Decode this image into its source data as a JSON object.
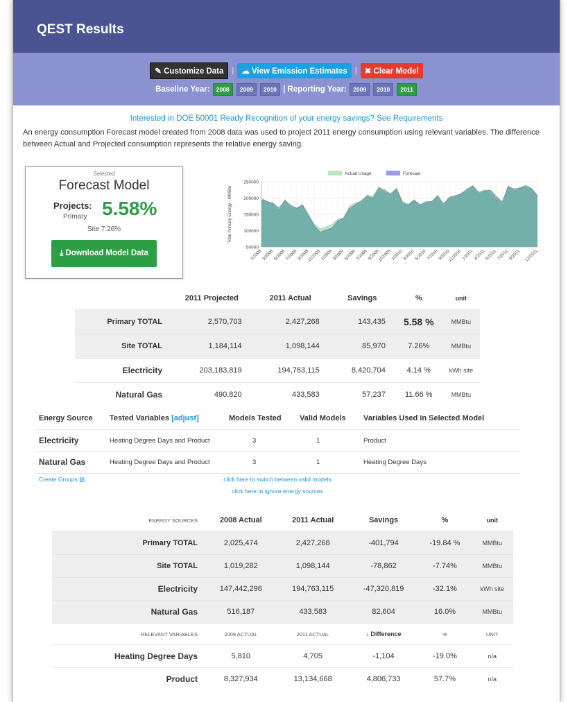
{
  "header": {
    "title": "QEST Results"
  },
  "toolbar": {
    "customize_label": "✎ Customize Data",
    "emission_label": "☁ View Emission Estimates",
    "clear_label": "✖ Clear Model",
    "baseline_label": "Baseline Year:",
    "reporting_label": "| Reporting Year:",
    "baseline_years": [
      "2008",
      "2009",
      "2010"
    ],
    "reporting_years": [
      "2009",
      "2010",
      "2011"
    ],
    "baseline_selected": "2008",
    "reporting_selected": "2011"
  },
  "interest_link": "Interested in DOE 50001 Ready Recognition of your energy savings? See Requirements",
  "description": "An energy consumption Forecast model created from 2008 data was used to project 2011 energy consumption using relevant variables. The difference between Actual and Projected consumption represents the relative energy saving.",
  "forecast_box": {
    "selected": "Selected",
    "title": "Forecast Model",
    "projects_label": "Projects:",
    "primary_label": "Primary",
    "primary_pct": "5.58%",
    "site_text": "Site 7.26%",
    "download_label": "⤓ Download Model Data"
  },
  "chart_data": {
    "type": "area",
    "ylabel": "Total Primary Energy - MMBtu",
    "legend": [
      "Actual Usage",
      "Forecast"
    ],
    "legend_position": "top",
    "colors": {
      "actual": "#b8e6b8",
      "forecast": "#9d9be6",
      "overlap": "#6fb0a4"
    },
    "ylim": [
      50000,
      250000
    ],
    "yticks": [
      "250000",
      "200000",
      "150000",
      "100000",
      "50000"
    ],
    "x": [
      "1/2008",
      "2/2008",
      "3/2008",
      "4/2008",
      "5/2008",
      "6/2008",
      "7/2008",
      "8/2008",
      "9/2008",
      "10/2008",
      "11/2008",
      "12/2008",
      "1/2009",
      "2/2009",
      "3/2009",
      "4/2009",
      "5/2009",
      "6/2009",
      "7/2009",
      "8/2009",
      "9/2009",
      "10/2009",
      "11/2009",
      "12/2009",
      "1/2010",
      "2/2010",
      "3/2010",
      "4/2010",
      "5/2010",
      "6/2010",
      "7/2010",
      "8/2010",
      "9/2010",
      "10/2010",
      "11/2010",
      "12/2010",
      "1/2011",
      "2/2011",
      "3/2011",
      "4/2011",
      "5/2011",
      "6/2011",
      "7/2011",
      "8/2011",
      "9/2011",
      "10/2011",
      "11/2011",
      "12/2011"
    ],
    "xticks": [
      "1/2008",
      "3/2008",
      "5/2008",
      "7/2008",
      "9/2008",
      "11/2008",
      "1/2009",
      "3/2009",
      "5/2009",
      "7/2009",
      "9/2009",
      "11/2009",
      "1/2010",
      "3/2010",
      "5/2010",
      "7/2010",
      "9/2010",
      "11/2010",
      "1/2011",
      "3/2011",
      "5/2011",
      "7/2011",
      "9/2011",
      "12/2011"
    ],
    "series": [
      {
        "name": "Actual Usage",
        "values": [
          200000,
          188000,
          185000,
          165000,
          195000,
          175000,
          170000,
          180000,
          150000,
          120000,
          105000,
          112000,
          118000,
          135000,
          140000,
          175000,
          185000,
          190000,
          210000,
          205000,
          235000,
          220000,
          215000,
          230000,
          190000,
          182000,
          195000,
          178000,
          190000,
          188000,
          210000,
          180000,
          205000,
          205000,
          215000,
          225000,
          240000,
          215000,
          225000,
          220000,
          200000,
          185000,
          238000,
          225000,
          232000,
          240000,
          230000,
          208000
        ]
      },
      {
        "name": "Forecast",
        "values": [
          195000,
          190000,
          182000,
          170000,
          192000,
          178000,
          168000,
          178000,
          145000,
          115000,
          95000,
          102000,
          108000,
          130000,
          138000,
          168000,
          180000,
          192000,
          205000,
          200000,
          230000,
          225000,
          210000,
          228000,
          185000,
          178000,
          192000,
          180000,
          186000,
          190000,
          205000,
          183000,
          200000,
          208000,
          212000,
          228000,
          236000,
          218000,
          222000,
          224000,
          205000,
          188000,
          235000,
          228000,
          230000,
          236000,
          228000,
          205000
        ]
      }
    ]
  },
  "projection_table": {
    "headers": [
      "",
      "2011 Projected",
      "2011 Actual",
      "Savings",
      "%",
      "unit"
    ],
    "rows": [
      {
        "label": "Primary TOTAL",
        "projected": "2,570,703",
        "actual": "2,427,268",
        "savings": "143,435",
        "pct": "5.58 %",
        "unit": "MMBtu"
      },
      {
        "label": "Site TOTAL",
        "projected": "1,184,114",
        "actual": "1,098,144",
        "savings": "85,970",
        "pct": "7.26%",
        "unit": "MMBtu"
      },
      {
        "label": "Electricity",
        "projected": "203,183,819",
        "actual": "194,763,115",
        "savings": "8,420,704",
        "pct": "4.14 %",
        "unit": "kWh site"
      },
      {
        "label": "Natural Gas",
        "projected": "490,820",
        "actual": "433,583",
        "savings": "57,237",
        "pct": "11.66 %",
        "unit": "MMBtu"
      }
    ]
  },
  "variables_table": {
    "headers": [
      "Energy Source",
      "Tested Variables",
      "Models Tested",
      "Valid Models",
      "Variables Used in Selected Model"
    ],
    "adjust_label": "[adjust]",
    "rows": [
      {
        "source": "Electricity",
        "tested": "Heating Degree Days and Product",
        "models": "3",
        "valid": "1",
        "used": "Product"
      },
      {
        "source": "Natural Gas",
        "tested": "Heating Degree Days and Product",
        "models": "3",
        "valid": "1",
        "used": "Heating Degree Days"
      }
    ]
  },
  "links": {
    "create_groups": "Create Groups",
    "switch_models": "click here to switch between valid models",
    "ignore_sources": "click here to ignore energy sources"
  },
  "comparison_table": {
    "headers": [
      "ENERGY SOURCES",
      "2008 Actual",
      "2011 Actual",
      "Savings",
      "%",
      "unit"
    ],
    "rows": [
      {
        "label": "Primary TOTAL",
        "a": "2,025,474",
        "b": "2,427,268",
        "savings": "-401,794",
        "pct": "-19.84 %",
        "unit": "MMBtu"
      },
      {
        "label": "Site TOTAL",
        "a": "1,019,282",
        "b": "1,098,144",
        "savings": "-78,862",
        "pct": "-7.74%",
        "unit": "MMBtu"
      },
      {
        "label": "Electricity",
        "a": "147,442,296",
        "b": "194,763,115",
        "savings": "-47,320,819",
        "pct": "-32.1%",
        "unit": "kWh site"
      },
      {
        "label": "Natural Gas",
        "a": "516,187",
        "b": "433,583",
        "savings": "82,604",
        "pct": "16.0%",
        "unit": "MMBtu"
      }
    ],
    "sub_headers": [
      "RELEVANT VARIABLES",
      "2008 ACTUAL",
      "2011 ACTUAL",
      "↓ Difference",
      "%",
      "UNIT"
    ],
    "var_rows": [
      {
        "label": "Heating Degree Days",
        "a": "5,810",
        "b": "4,705",
        "diff": "-1,104",
        "pct": "-19.0%",
        "unit": "n/a"
      },
      {
        "label": "Product",
        "a": "8,327,934",
        "b": "13,134,668",
        "diff": "4,806,733",
        "pct": "57.7%",
        "unit": "n/a"
      }
    ]
  }
}
